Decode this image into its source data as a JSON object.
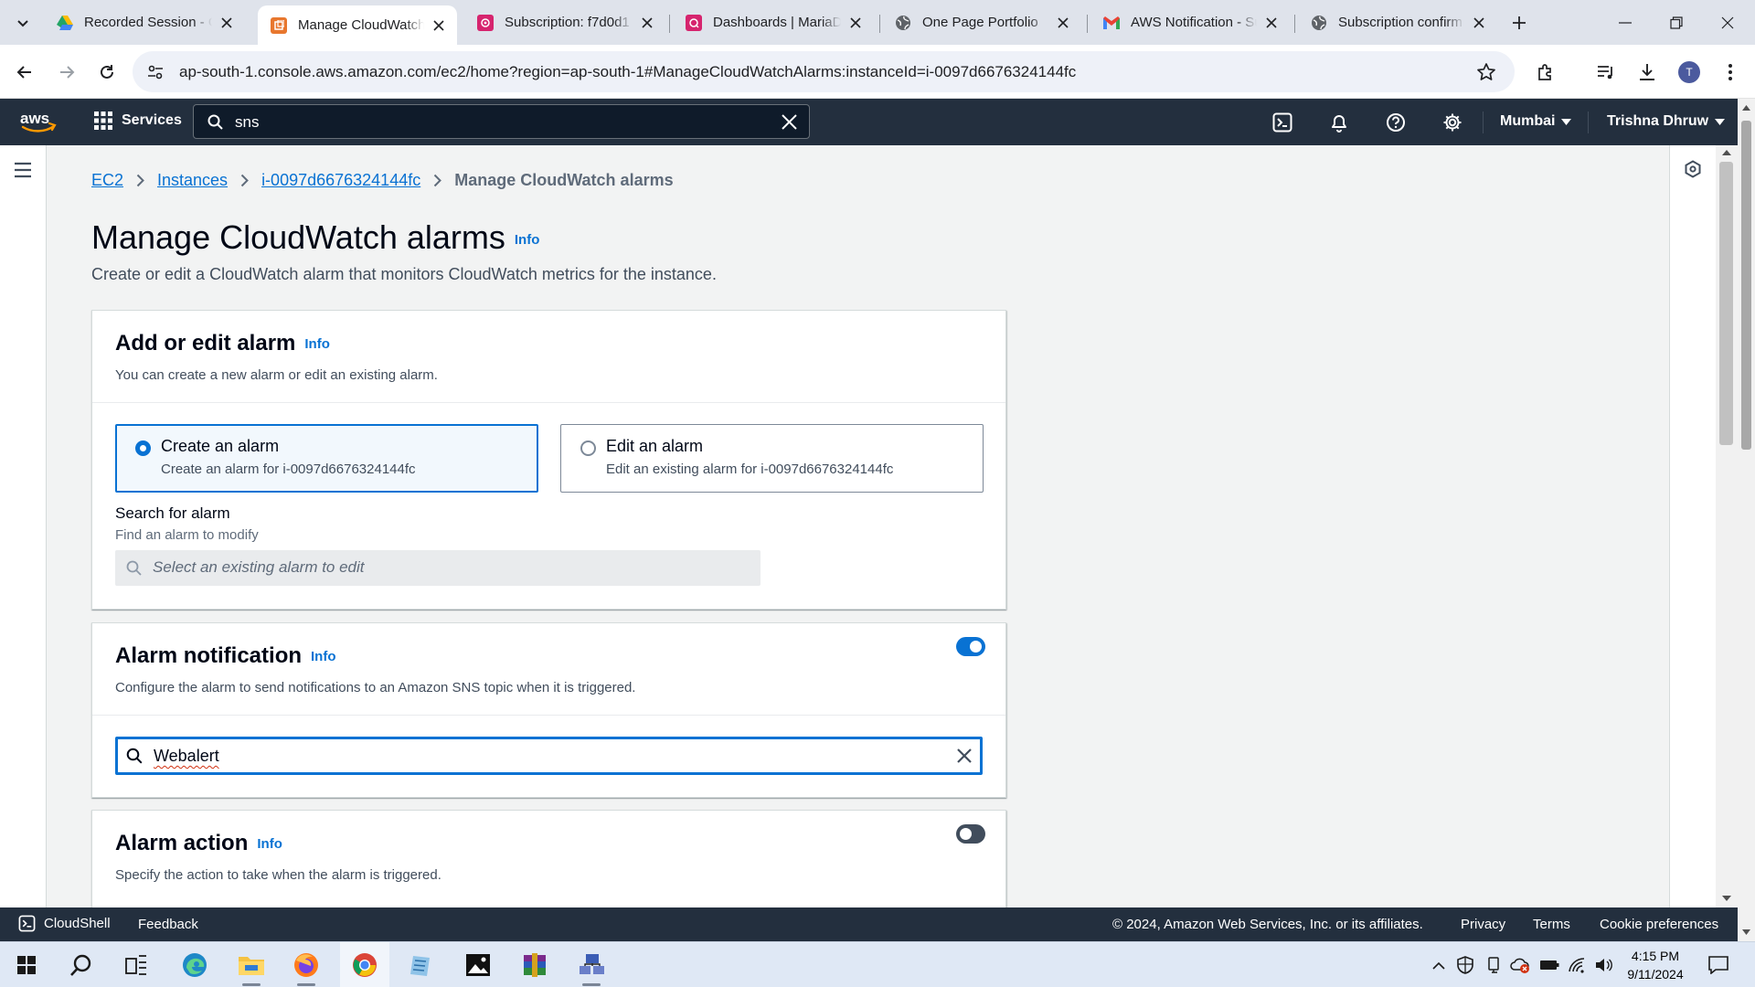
{
  "browser": {
    "tabs": [
      {
        "title": "Recorded Session - G",
        "icon": "google-drive-icon"
      },
      {
        "title": "Manage CloudWatch",
        "icon": "aws-ec2-icon",
        "active": true
      },
      {
        "title": "Subscription: f7d0d1",
        "icon": "aws-sns-icon"
      },
      {
        "title": "Dashboards | MariaD",
        "icon": "mariadb-dashboard-icon"
      },
      {
        "title": "One Page Portfolio",
        "icon": "globe-icon"
      },
      {
        "title": "AWS Notification - Su",
        "icon": "gmail-icon"
      },
      {
        "title": "Subscription confirm",
        "icon": "globe-icon"
      }
    ],
    "url": "ap-south-1.console.aws.amazon.com/ec2/home?region=ap-south-1#ManageCloudWatchAlarms:instanceId=i-0097d6676324144fc",
    "profile_initial": "T"
  },
  "aws_nav": {
    "services_label": "Services",
    "search_value": "sns",
    "region": "Mumbai",
    "user": "Trishna Dhruw"
  },
  "breadcrumb": [
    "EC2",
    "Instances",
    "i-0097d6676324144fc",
    "Manage CloudWatch alarms"
  ],
  "page": {
    "title": "Manage CloudWatch alarms",
    "info_label": "Info",
    "description": "Create or edit a CloudWatch alarm that monitors CloudWatch metrics for the instance."
  },
  "add_edit_panel": {
    "title": "Add or edit alarm",
    "info_label": "Info",
    "description": "You can create a new alarm or edit an existing alarm.",
    "options": [
      {
        "label": "Create an alarm",
        "description": "Create an alarm for i-0097d6676324144fc",
        "selected": true
      },
      {
        "label": "Edit an alarm",
        "description": "Edit an existing alarm for i-0097d6676324144fc",
        "selected": false
      }
    ],
    "search": {
      "label": "Search for alarm",
      "description": "Find an alarm to modify",
      "placeholder": "Select an existing alarm to edit"
    }
  },
  "notification_panel": {
    "title": "Alarm notification",
    "info_label": "Info",
    "description": "Configure the alarm to send notifications to an Amazon SNS topic when it is triggered.",
    "enabled": true,
    "topic_value": "Webalert"
  },
  "action_panel": {
    "title": "Alarm action",
    "info_label": "Info",
    "description": "Specify the action to take when the alarm is triggered.",
    "enabled": false
  },
  "aws_footer": {
    "cloudshell": "CloudShell",
    "feedback": "Feedback",
    "copyright": "© 2024, Amazon Web Services, Inc. or its affiliates.",
    "links": [
      "Privacy",
      "Terms",
      "Cookie preferences"
    ]
  },
  "taskbar": {
    "time": "4:15 PM",
    "date": "9/11/2024",
    "apps": [
      "windows-start",
      "search",
      "task-view",
      "edge",
      "file-explorer",
      "firefox",
      "chrome",
      "notepad",
      "photos",
      "winrar",
      "network-tool"
    ]
  },
  "colors": {
    "aws_nav_bg": "#232f3e",
    "accent_blue": "#0972d3",
    "page_bg": "#f2f3f3"
  }
}
